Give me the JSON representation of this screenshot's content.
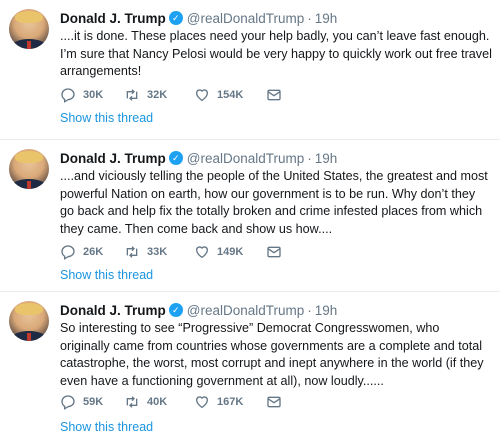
{
  "tweets": [
    {
      "name": "Donald J. Trump",
      "handle": "@realDonaldTrump",
      "separator": "·",
      "time": "19h",
      "text": "....it is done. These places need your help badly, you can’t leave fast enough. I’m sure that Nancy Pelosi would be very happy to quickly work out free travel arrangements!",
      "replies": "30K",
      "retweets": "32K",
      "likes": "154K",
      "show_thread": "Show this thread"
    },
    {
      "name": "Donald J. Trump",
      "handle": "@realDonaldTrump",
      "separator": "·",
      "time": "19h",
      "text": "....and viciously telling the people of the United States, the greatest and most powerful Nation on earth, how our government is to be run. Why don’t they go back and help fix the totally broken and crime infested places from which they came. Then come back and show us how....",
      "replies": "26K",
      "retweets": "33K",
      "likes": "149K",
      "show_thread": "Show this thread"
    },
    {
      "name": "Donald J. Trump",
      "handle": "@realDonaldTrump",
      "separator": "·",
      "time": "19h",
      "text": "So interesting to see “Progressive” Democrat Congresswomen, who originally came from countries whose governments are a complete and total catastrophe, the worst, most corrupt and inept anywhere in the world (if they even have a functioning government at all), now loudly......",
      "replies": "59K",
      "retweets": "40K",
      "likes": "167K",
      "show_thread": "Show this thread"
    }
  ],
  "icons": {
    "reply": "reply-icon",
    "retweet": "retweet-icon",
    "like": "heart-icon",
    "dm": "envelope-icon",
    "verified": "verified-badge-icon"
  },
  "colors": {
    "link": "#1b95e0",
    "muted": "#657786",
    "verified": "#1da1f2",
    "divider": "#e6ecf0"
  }
}
